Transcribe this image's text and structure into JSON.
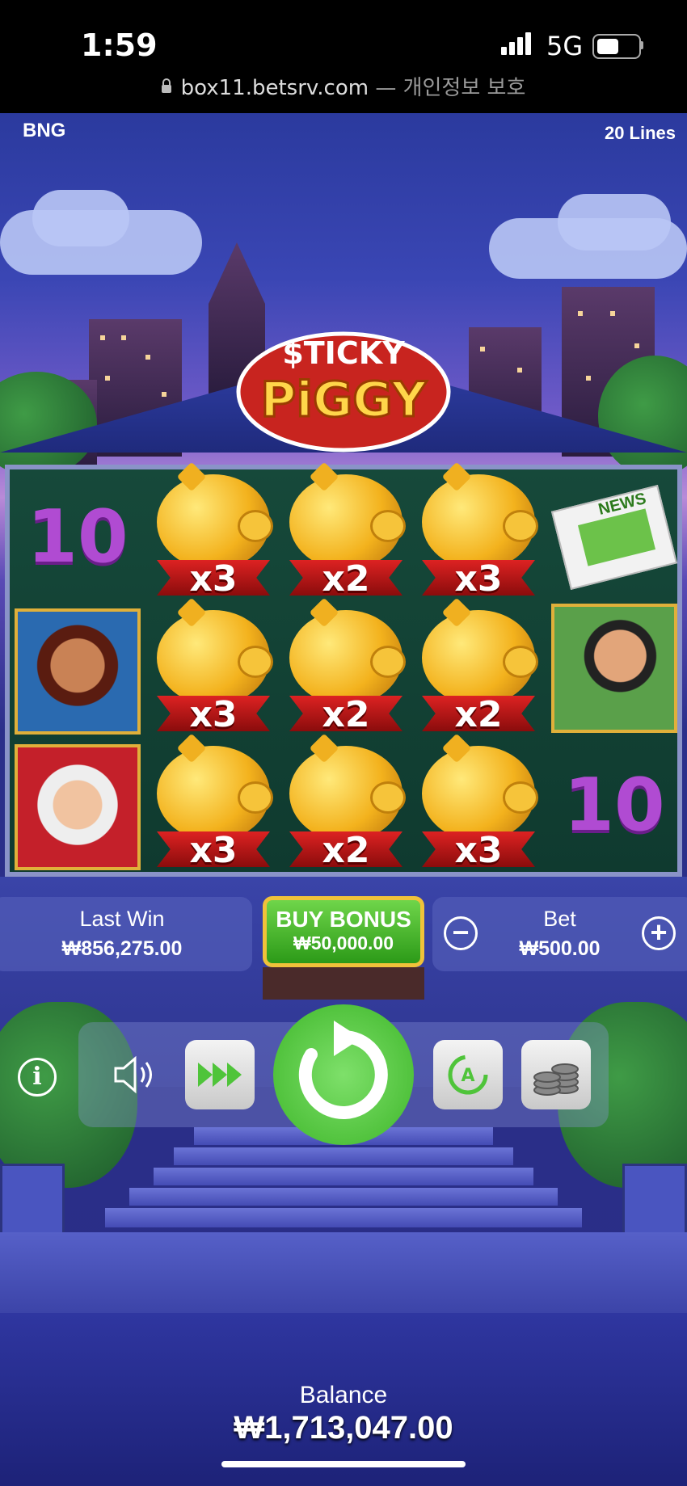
{
  "status_bar": {
    "time": "1:59",
    "network": "5G",
    "url": "box11.betsrv.com",
    "url_suffix": "— 개인정보 보호"
  },
  "game": {
    "provider": "BNG",
    "lines": "20 Lines",
    "logo_line1": "$TICKY",
    "logo_line2": "PiGGY",
    "symbols": {
      "ten_symbol": "10",
      "multipliers": [
        "x3",
        "x2",
        "x3",
        "x3",
        "x2",
        "x2",
        "x3",
        "x2",
        "x3"
      ],
      "news_label": "NEWS"
    }
  },
  "panels": {
    "last_win_label": "Last Win",
    "last_win_value": "₩856,275.00",
    "buy_bonus_label": "BUY BONUS",
    "buy_bonus_price": "₩50,000.00",
    "bet_label": "Bet",
    "bet_value": "₩500.00",
    "minus": "−",
    "plus": "+"
  },
  "controls": {
    "info": "i",
    "auto_label": "A"
  },
  "balance": {
    "label": "Balance",
    "value": "₩1,713,047.00"
  },
  "colors": {
    "spin_green": "#4fc43a",
    "buy_border": "#f0c23a",
    "ten_purple": "#b04bd2"
  }
}
